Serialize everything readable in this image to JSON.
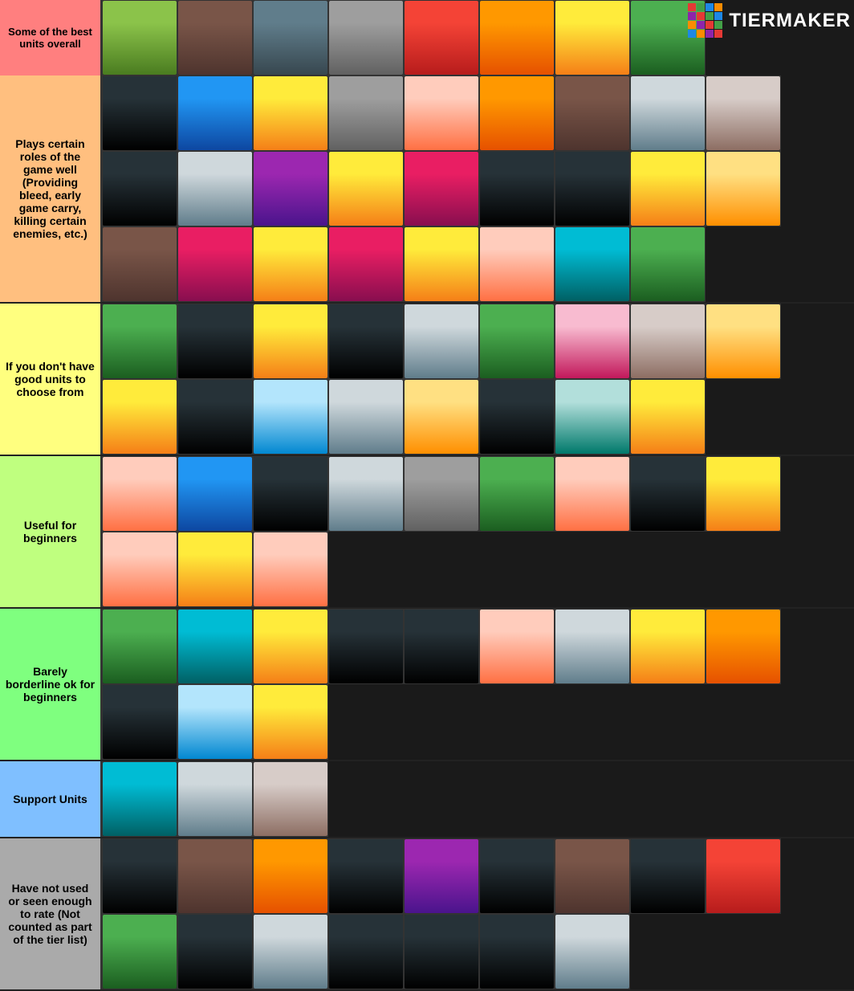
{
  "app": {
    "title": "TierMaker",
    "logo_text": "TIERMAKER"
  },
  "tiers": [
    {
      "id": "s",
      "label": "Some of the best units overall",
      "color": "#ff7f7f",
      "units": [
        {
          "id": 1,
          "color": "c1"
        },
        {
          "id": 2,
          "color": "c2"
        },
        {
          "id": 3,
          "color": "c3"
        },
        {
          "id": 4,
          "color": "c4"
        },
        {
          "id": 5,
          "color": "c5"
        },
        {
          "id": 6,
          "color": "c6"
        },
        {
          "id": 7,
          "color": "c7"
        },
        {
          "id": 8,
          "color": "c8"
        }
      ]
    },
    {
      "id": "a",
      "label": "Plays certain roles of the game well (Providing bleed, early game carry, killing certain enemies, etc.)",
      "color": "#ffbf7f",
      "rows": [
        [
          {
            "id": 9,
            "color": "c24"
          },
          {
            "id": 10,
            "color": "c9"
          },
          {
            "id": 11,
            "color": "c7"
          },
          {
            "id": 12,
            "color": "c4"
          },
          {
            "id": 13,
            "color": "c17"
          },
          {
            "id": 14,
            "color": "c6"
          },
          {
            "id": 15,
            "color": "c2"
          },
          {
            "id": 16,
            "color": "c16"
          },
          {
            "id": 17,
            "color": "c15"
          },
          {
            "id": 18,
            "color": "c24"
          }
        ],
        [
          {
            "id": 19,
            "color": "c16"
          },
          {
            "id": 20,
            "color": "c10"
          },
          {
            "id": 21,
            "color": "c7"
          },
          {
            "id": 22,
            "color": "c12"
          },
          {
            "id": 23,
            "color": "c24"
          },
          {
            "id": 24,
            "color": "c24"
          },
          {
            "id": 25,
            "color": "c7"
          },
          {
            "id": 26,
            "color": "c20"
          },
          {
            "id": 27,
            "color": "c2"
          },
          {
            "id": 28,
            "color": "c12"
          }
        ],
        [
          {
            "id": 29,
            "color": "c7"
          },
          {
            "id": 30,
            "color": "c12"
          },
          {
            "id": 31,
            "color": "c7"
          },
          {
            "id": 32,
            "color": "c17"
          },
          {
            "id": 33,
            "color": "c8"
          },
          {
            "id": 34,
            "color": "c8"
          }
        ]
      ]
    },
    {
      "id": "b",
      "label": "If you don't have good units to choose from",
      "color": "#ffff7f",
      "rows": [
        [
          {
            "id": 35,
            "color": "c8"
          },
          {
            "id": 36,
            "color": "c24"
          },
          {
            "id": 37,
            "color": "c7"
          },
          {
            "id": 38,
            "color": "c24"
          },
          {
            "id": 39,
            "color": "c16"
          },
          {
            "id": 40,
            "color": "c8"
          },
          {
            "id": 41,
            "color": "c22"
          },
          {
            "id": 42,
            "color": "c15"
          },
          {
            "id": 43,
            "color": "c20"
          },
          {
            "id": 44,
            "color": "c7"
          }
        ],
        [
          {
            "id": 45,
            "color": "c24"
          },
          {
            "id": 46,
            "color": "c21"
          },
          {
            "id": 47,
            "color": "c16"
          },
          {
            "id": 48,
            "color": "c20"
          },
          {
            "id": 49,
            "color": "c24"
          },
          {
            "id": 50,
            "color": "c14"
          },
          {
            "id": 51,
            "color": "c7"
          }
        ]
      ]
    },
    {
      "id": "c",
      "label": "Useful for beginners",
      "color": "#bfff7f",
      "rows": [
        [
          {
            "id": 52,
            "color": "c17"
          },
          {
            "id": 53,
            "color": "c9"
          },
          {
            "id": 54,
            "color": "c24"
          },
          {
            "id": 55,
            "color": "c16"
          },
          {
            "id": 56,
            "color": "c4"
          },
          {
            "id": 57,
            "color": "c8"
          },
          {
            "id": 58,
            "color": "c17"
          },
          {
            "id": 59,
            "color": "c24"
          },
          {
            "id": 60,
            "color": "c7"
          },
          {
            "id": 61,
            "color": "c17"
          }
        ],
        [
          {
            "id": 62,
            "color": "c7"
          },
          {
            "id": 63,
            "color": "c17"
          }
        ]
      ]
    },
    {
      "id": "d",
      "label": "Barely borderline ok for beginners",
      "color": "#7fff7f",
      "rows": [
        [
          {
            "id": 64,
            "color": "c8"
          },
          {
            "id": 65,
            "color": "c11"
          },
          {
            "id": 66,
            "color": "c7"
          },
          {
            "id": 67,
            "color": "c24"
          },
          {
            "id": 68,
            "color": "c24"
          },
          {
            "id": 69,
            "color": "c17"
          },
          {
            "id": 70,
            "color": "c16"
          },
          {
            "id": 71,
            "color": "c7"
          },
          {
            "id": 72,
            "color": "c6"
          },
          {
            "id": 73,
            "color": "c24"
          }
        ],
        [
          {
            "id": 74,
            "color": "c21"
          },
          {
            "id": 75,
            "color": "c7"
          }
        ]
      ]
    },
    {
      "id": "support",
      "label": "Support Units",
      "color": "#7fbfff",
      "units": [
        {
          "id": 76,
          "color": "c11"
        },
        {
          "id": 77,
          "color": "c16"
        },
        {
          "id": 78,
          "color": "c15"
        }
      ]
    },
    {
      "id": "unrated",
      "label": "Have not used or seen enough to rate  (Not counted as part of the tier list)",
      "color": "#aaaaaa",
      "rows": [
        [
          {
            "id": 79,
            "color": "c24"
          },
          {
            "id": 80,
            "color": "c2"
          },
          {
            "id": 81,
            "color": "c6"
          },
          {
            "id": 82,
            "color": "c24"
          },
          {
            "id": 83,
            "color": "c10"
          },
          {
            "id": 84,
            "color": "c24"
          },
          {
            "id": 85,
            "color": "c2"
          },
          {
            "id": 86,
            "color": "c24"
          },
          {
            "id": 87,
            "color": "c5"
          },
          {
            "id": 88,
            "color": "c8"
          }
        ],
        [
          {
            "id": 89,
            "color": "c24"
          },
          {
            "id": 90,
            "color": "c16"
          },
          {
            "id": 91,
            "color": "c24"
          },
          {
            "id": 92,
            "color": "c24"
          },
          {
            "id": 93,
            "color": "c24"
          },
          {
            "id": 94,
            "color": "c16"
          }
        ]
      ]
    }
  ]
}
